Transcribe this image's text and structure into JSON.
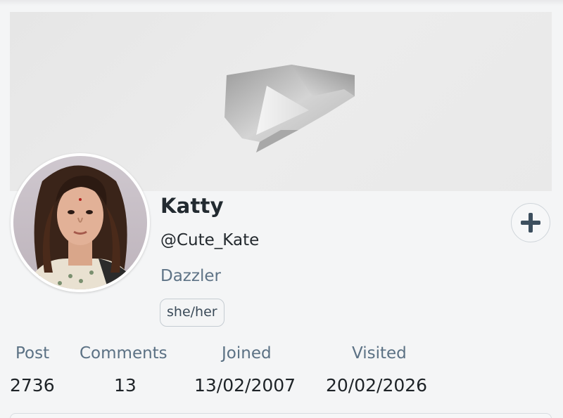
{
  "profile": {
    "display_name": "Katty",
    "handle": "@Cute_Kate",
    "rank": "Dazzler",
    "pronouns": "she/her"
  },
  "banner": {
    "icon": "play-logo-icon"
  },
  "actions": {
    "add_icon": "plus-icon"
  },
  "stats": [
    {
      "label": "Post",
      "value": "2736"
    },
    {
      "label": "Comments",
      "value": "13"
    },
    {
      "label": "Joined",
      "value": "13/02/2007"
    },
    {
      "label": "Visited",
      "value": "20/02/2026"
    }
  ],
  "colors": {
    "accent": "#3d4f5e",
    "muted_label": "#5b7184",
    "background": "#f4f5f6"
  }
}
